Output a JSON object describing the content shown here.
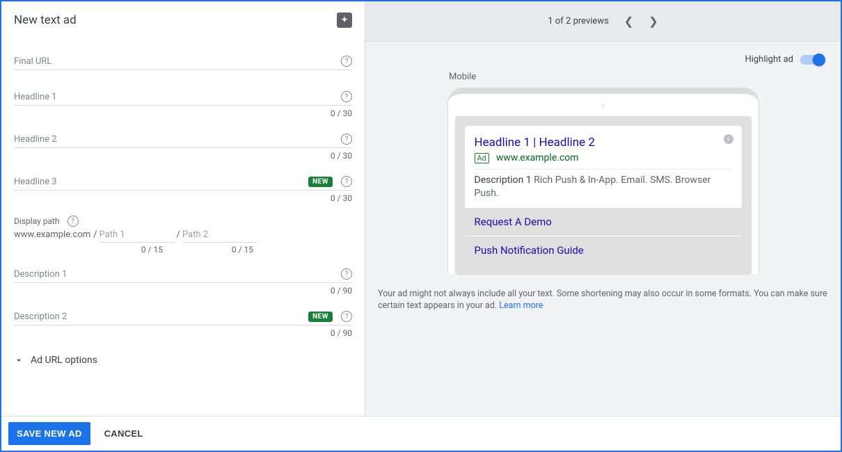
{
  "title": "New text ad",
  "fields": {
    "final_url": {
      "label": "Final URL"
    },
    "headline1": {
      "label": "Headline 1",
      "counter": "0 / 30"
    },
    "headline2": {
      "label": "Headline 2",
      "counter": "0 / 30"
    },
    "headline3": {
      "label": "Headline 3",
      "counter": "0 / 30",
      "badge": "NEW"
    },
    "description1": {
      "label": "Description 1",
      "counter": "0 / 90"
    },
    "description2": {
      "label": "Description 2",
      "counter": "0 / 90",
      "badge": "NEW"
    }
  },
  "display_path": {
    "label": "Display path",
    "domain": "www.example.com",
    "sep": "/",
    "path1_placeholder": "Path 1",
    "path2_placeholder": "Path 2",
    "counter1": "0 / 15",
    "counter2": "0 / 15"
  },
  "ad_url_options": "Ad URL options",
  "footer": {
    "save": "SAVE NEW AD",
    "cancel": "CANCEL"
  },
  "preview": {
    "counter": "1 of 2 previews",
    "highlight_label": "Highlight ad",
    "mobile_label": "Mobile",
    "ad": {
      "headline": "Headline 1 | Headline 2",
      "badge": "Ad",
      "url": "www.example.com",
      "desc_lead": "Description 1",
      "desc_rest": " Rich Push & In-App. Email. SMS. Browser Push.",
      "sitelink1": "Request A Demo",
      "sitelink2": "Push Notification Guide"
    },
    "disclaimer": "Your ad might not always include all your text. Some shortening may also occur in some formats. You can make sure certain text appears in your ad. ",
    "learn_more": "Learn more"
  }
}
